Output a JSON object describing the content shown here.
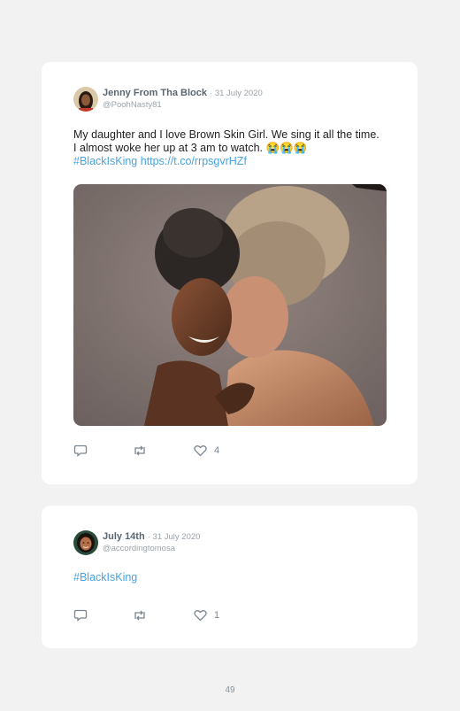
{
  "tweets": [
    {
      "author": "Jenny From Tha Block",
      "date": "· 31 July 2020",
      "handle": "@PoohNasty81",
      "text": "My daughter and I love Brown Skin Girl. We sing it all the time. I almost woke her up at 3 am to watch. 😭😭😭",
      "hashtag": "#BlackIsKing",
      "url": "https://t.co/rrpsgvrHZf",
      "likes": "4"
    },
    {
      "author": "July 14th",
      "date": "· 31 July 2020",
      "handle": "@accordingtomosa",
      "hashtag": "#BlackIsKing",
      "likes": "1"
    }
  ],
  "page_number": "49",
  "icons": [
    "reply-icon",
    "retweet-icon",
    "heart-icon"
  ],
  "colors": {
    "link": "#4aa3df",
    "name": "#5a6670",
    "muted": "#9aa3aa",
    "background": "#f2f2f3"
  }
}
